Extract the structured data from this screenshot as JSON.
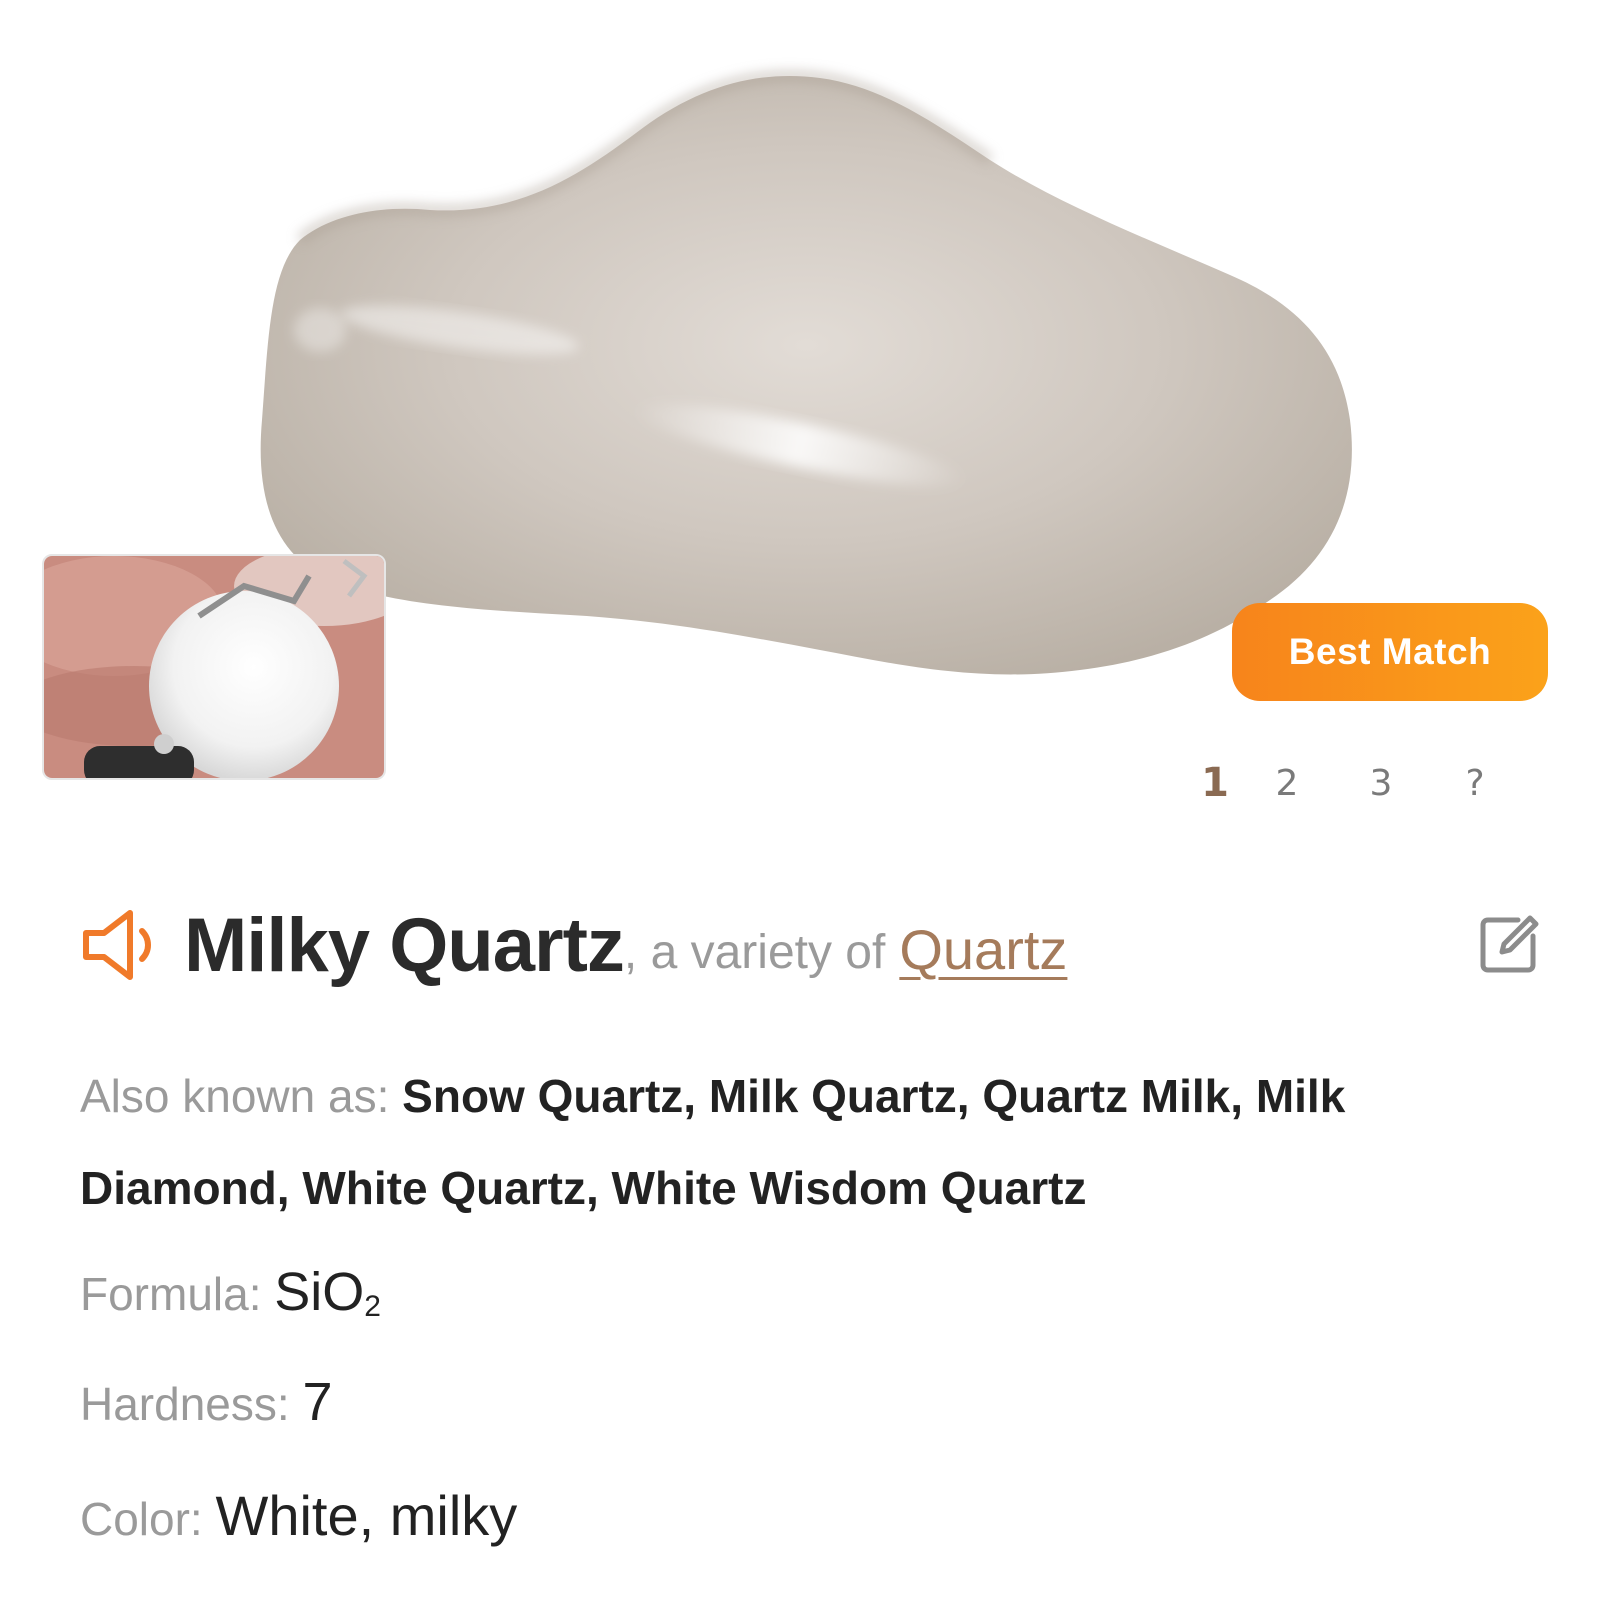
{
  "hero": {
    "badge_label": "Best Match",
    "pager": [
      "1",
      "2",
      "3",
      "?"
    ],
    "active_page": "1"
  },
  "title": {
    "name": "Milky Quartz",
    "variety_prefix": ", a variety of ",
    "parent_link": "Quartz"
  },
  "details": {
    "aka_label": "Also known as: ",
    "aka_value": "Snow Quartz, Milk Quartz, Quartz Milk, Milk Diamond, White Quartz, White Wisdom Quartz",
    "formula_label": "Formula: ",
    "formula_main": "SiO",
    "formula_sub": "2",
    "hardness_label": "Hardness: ",
    "hardness_value": "7",
    "color_label": "Color: ",
    "color_value": "White, milky"
  },
  "icons": {
    "speaker": "speaker-icon",
    "edit": "edit-icon"
  },
  "colors": {
    "accent_orange": "#f7841b",
    "link_brown": "#a57b5b",
    "label_gray": "#9a9a9a",
    "text_dark": "#222222"
  }
}
